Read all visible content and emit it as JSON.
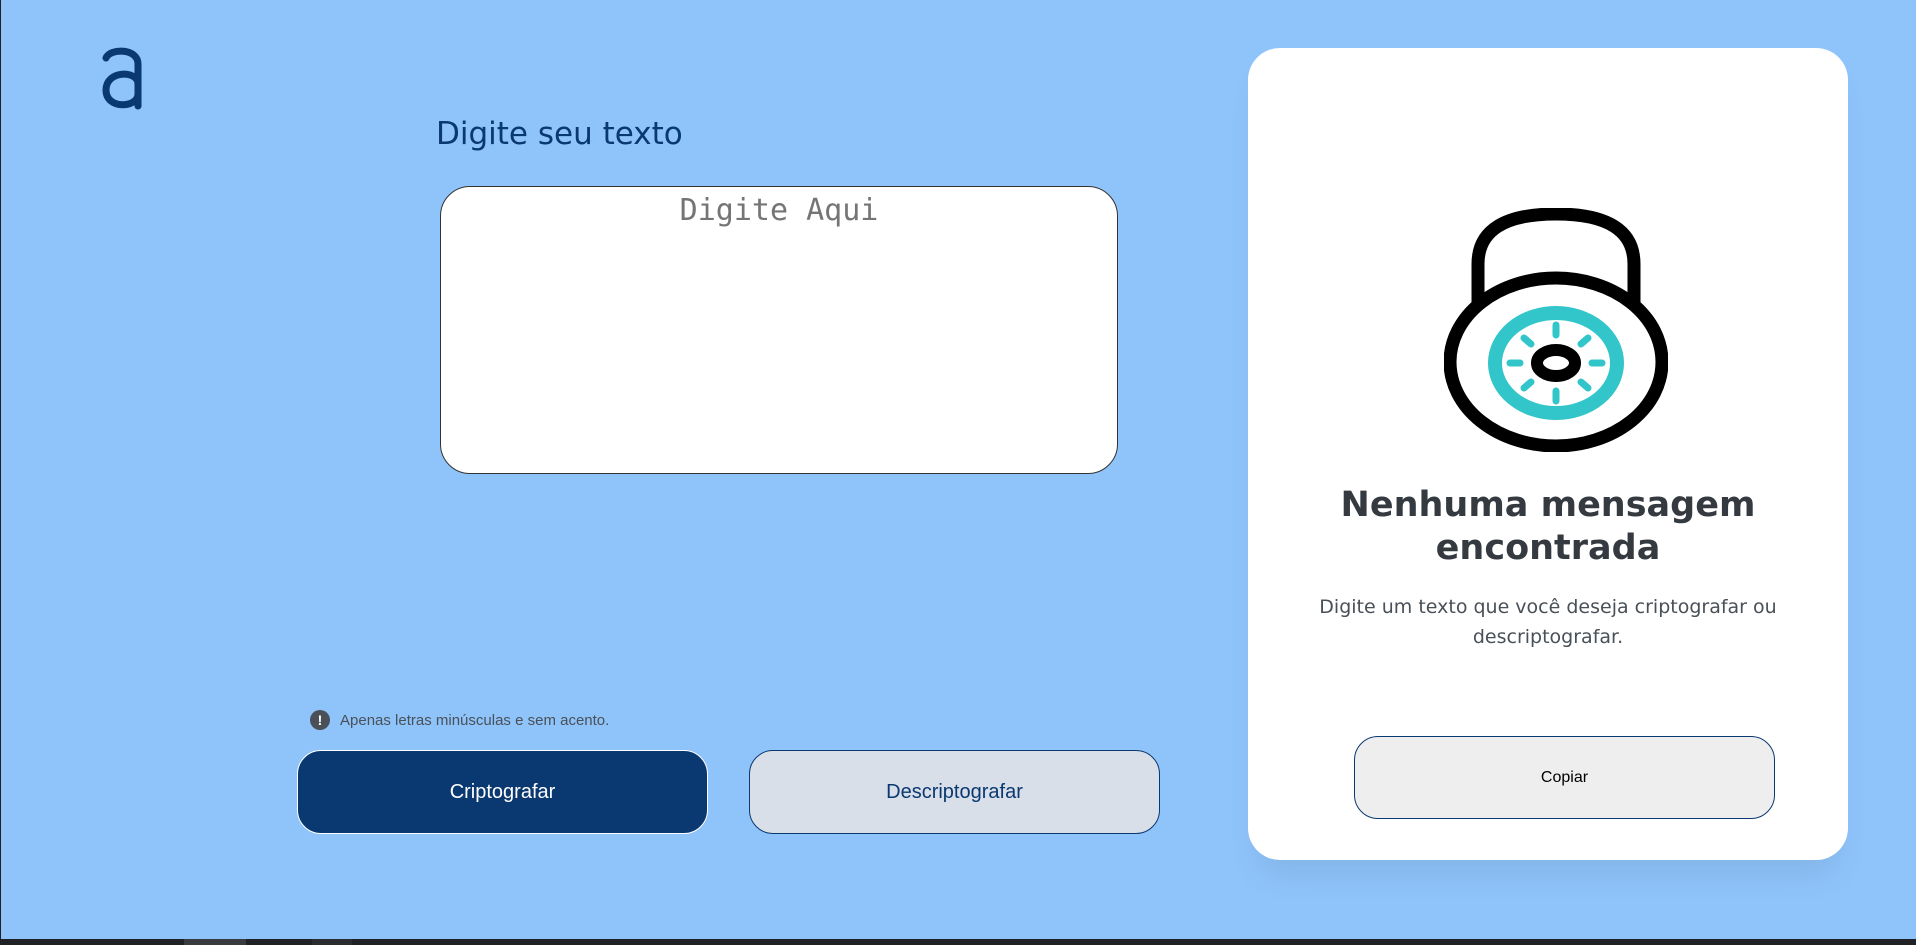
{
  "colors": {
    "page_background": "#8fc4fb",
    "primary": "#0a3871",
    "secondary_button": "#d8dfe8",
    "copy_button": "#eeeeef",
    "lock_accent": "#32c5c9"
  },
  "logo": {
    "icon": "alura-logo-icon"
  },
  "input": {
    "title": "Digite seu texto",
    "placeholder": "Digite Aqui"
  },
  "hint": {
    "icon": "exclamation-circle-icon",
    "glyph": "!",
    "text": "Apenas letras minúsculas e sem acento."
  },
  "buttons": {
    "encrypt_label": "Criptografar",
    "decrypt_label": "Descriptografar"
  },
  "output": {
    "icon": "padlock-icon",
    "title": "Nenhuma mensagem encontrada",
    "text": "Digite um texto que você deseja criptografar ou descriptografar.",
    "copy_label": "Copiar"
  }
}
